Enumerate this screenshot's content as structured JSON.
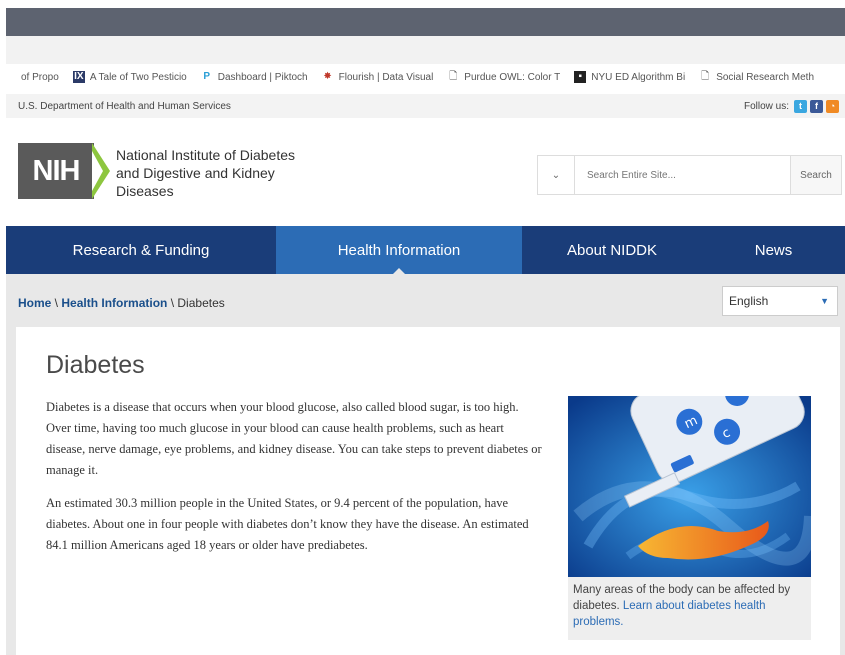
{
  "bookmarks": [
    {
      "label": "of Propo",
      "icon": "page-icon"
    },
    {
      "label": "A Tale of Two Pesticio",
      "icon": "ix-icon"
    },
    {
      "label": "Dashboard | Piktoch",
      "icon": "piktochart-icon"
    },
    {
      "label": "Flourish | Data Visual",
      "icon": "flourish-icon"
    },
    {
      "label": "Purdue OWL: Color T",
      "icon": "page-icon"
    },
    {
      "label": "NYU ED Algorithm Bi",
      "icon": "nyu-icon"
    },
    {
      "label": "Social Research Meth",
      "icon": "page-icon"
    }
  ],
  "govbar": {
    "department": "U.S. Department of Health and Human Services",
    "follow_label": "Follow us:"
  },
  "header": {
    "logo_text": "NIH",
    "org_name": "National Institute of Diabetes and Digestive and Kidney Diseases"
  },
  "search": {
    "placeholder": "Search Entire Site...",
    "button_label": "Search"
  },
  "nav": {
    "items": [
      "Research & Funding",
      "Health Information",
      "About NIDDK",
      "News"
    ]
  },
  "breadcrumb": {
    "home": "Home",
    "sep": " \\ ",
    "section": "Health Information",
    "current": "Diabetes"
  },
  "language": {
    "selected": "English"
  },
  "article": {
    "title": "Diabetes",
    "paragraph1": "Diabetes is a disease that occurs when your blood glucose, also called blood sugar, is too high. Over time, having too much glucose in your blood can cause health problems, such as heart disease, nerve damage, eye problems, and kidney disease. You can take steps to prevent diabetes or manage it.",
    "paragraph2": "An estimated 30.3 million people in the United States, or 9.4 percent of the population, have diabetes. About one in four people with diabetes don’t know they have the disease. An estimated 84.1 million Americans aged 18 years or older have prediabetes."
  },
  "figure": {
    "caption_text": "Many areas of the body can be affected by diabetes.",
    "caption_link": "Learn about diabetes health problems."
  },
  "colors": {
    "nav_bg": "#1a3d79",
    "nav_active": "#2c6cb5",
    "logo_green": "#8dc63f",
    "link_blue": "#1a4f8b"
  }
}
